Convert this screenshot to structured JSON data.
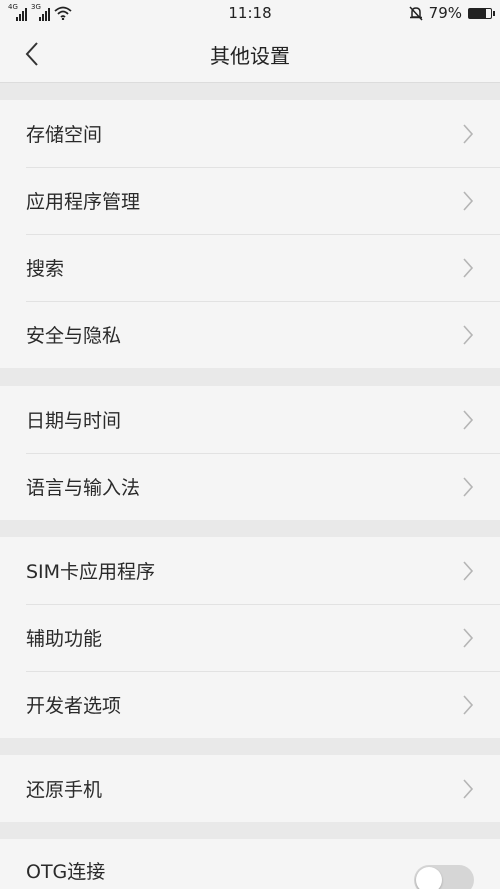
{
  "status_bar": {
    "sim1_tag": "4G",
    "sim2_tag": "3G",
    "time": "11:18",
    "battery_percent": "79%",
    "battery_level": 0.79
  },
  "header": {
    "title": "其他设置",
    "back_icon": "chevron-left-icon"
  },
  "groups": [
    {
      "items": [
        {
          "label": "存储空间"
        },
        {
          "label": "应用程序管理"
        },
        {
          "label": "搜索"
        },
        {
          "label": "安全与隐私"
        }
      ]
    },
    {
      "items": [
        {
          "label": "日期与时间"
        },
        {
          "label": "语言与输入法"
        }
      ]
    },
    {
      "items": [
        {
          "label": "SIM卡应用程序"
        },
        {
          "label": "辅助功能"
        },
        {
          "label": "开发者选项"
        }
      ]
    },
    {
      "items": [
        {
          "label": "还原手机"
        }
      ]
    }
  ],
  "otg": {
    "label": "OTG连接",
    "enabled": false
  },
  "colors": {
    "page_bg": "#e9e9e9",
    "row_bg": "#f5f5f5",
    "chevron": "#b5b5b5",
    "toggle_off": "#d6d6d6"
  }
}
